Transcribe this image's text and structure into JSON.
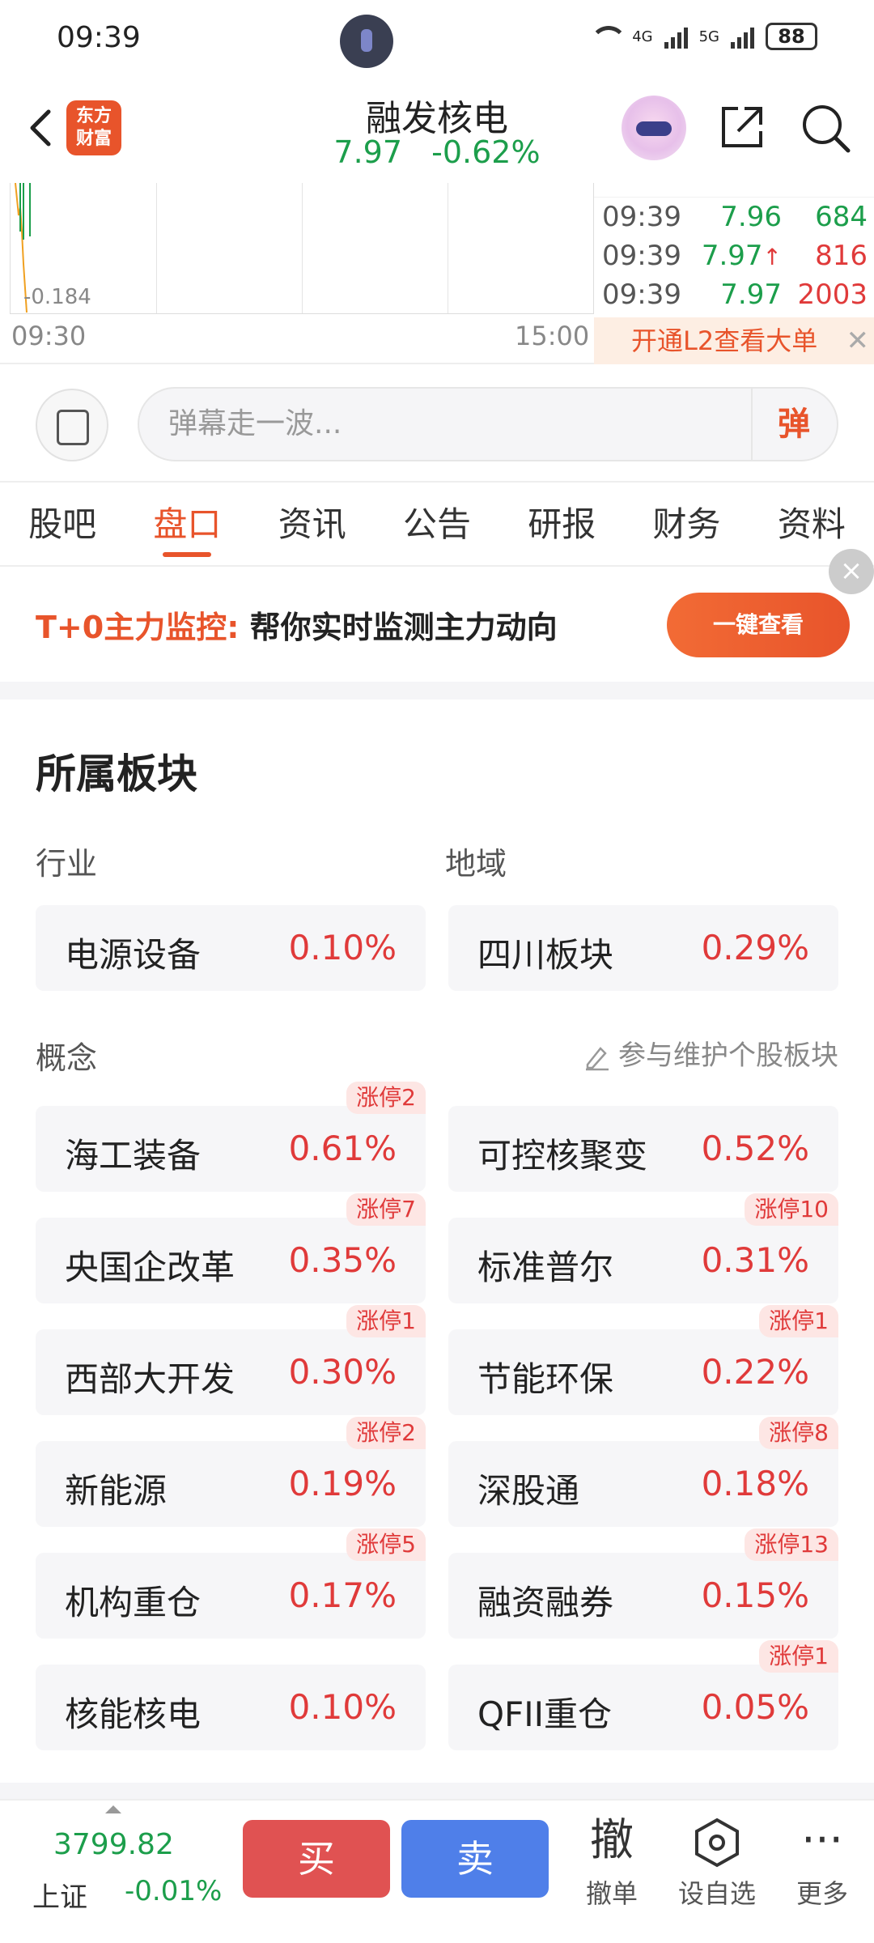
{
  "status_bar": {
    "time": "09:39",
    "signal_4g": "4G",
    "signal_5g": "5G",
    "battery": "88"
  },
  "header": {
    "logo_line1": "东方",
    "logo_line2": "财富",
    "stock_name": "融发核电",
    "price": "7.97",
    "change_pct": "-0.62%"
  },
  "chart": {
    "min_label": "-0.184",
    "x_start": "09:30",
    "x_end": "15:00",
    "ticks": [
      {
        "time": "09:39",
        "price": "7.96",
        "volume": "684",
        "direction": "",
        "color": "green"
      },
      {
        "time": "09:39",
        "price": "7.97",
        "volume": "816",
        "direction": "↑",
        "color": "red"
      },
      {
        "time": "09:39",
        "price": "7.97",
        "volume": "2003",
        "direction": "",
        "color": "red"
      }
    ],
    "l2_banner": "开通L2查看大单"
  },
  "danmaku": {
    "placeholder": "弹幕走一波...",
    "send_label": "弹"
  },
  "tabs": [
    {
      "label": "股吧",
      "active": false
    },
    {
      "label": "盘口",
      "active": true
    },
    {
      "label": "资讯",
      "active": false
    },
    {
      "label": "公告",
      "active": false
    },
    {
      "label": "研报",
      "active": false
    },
    {
      "label": "财务",
      "active": false
    },
    {
      "label": "资料",
      "active": false
    }
  ],
  "promo": {
    "highlight": "T+0主力监控:",
    "text": "帮你实时监测主力动向",
    "button": "一键查看",
    "close": "×"
  },
  "sectors": {
    "title": "所属板块",
    "industry_label": "行业",
    "region_label": "地域",
    "concept_label": "概念",
    "maintain_label": "参与维护个股板块",
    "industry": {
      "name": "电源设备",
      "pct": "0.10%"
    },
    "region": {
      "name": "四川板块",
      "pct": "0.29%"
    },
    "concepts": [
      {
        "name": "海工装备",
        "pct": "0.61%",
        "badge": "涨停2"
      },
      {
        "name": "可控核聚变",
        "pct": "0.52%",
        "badge": ""
      },
      {
        "name": "央国企改革",
        "pct": "0.35%",
        "badge": "涨停7"
      },
      {
        "name": "标准普尔",
        "pct": "0.31%",
        "badge": "涨停10"
      },
      {
        "name": "西部大开发",
        "pct": "0.30%",
        "badge": "涨停1"
      },
      {
        "name": "节能环保",
        "pct": "0.22%",
        "badge": "涨停1"
      },
      {
        "name": "新能源",
        "pct": "0.19%",
        "badge": "涨停2"
      },
      {
        "name": "深股通",
        "pct": "0.18%",
        "badge": "涨停8"
      },
      {
        "name": "机构重仓",
        "pct": "0.17%",
        "badge": "涨停5"
      },
      {
        "name": "融资融券",
        "pct": "0.15%",
        "badge": "涨停13"
      },
      {
        "name": "核能核电",
        "pct": "0.10%",
        "badge": ""
      },
      {
        "name": "QFII重仓",
        "pct": "0.05%",
        "badge": "涨停1"
      }
    ]
  },
  "bottom_bar": {
    "index_value": "3799.82",
    "index_name": "上证",
    "index_change": "-0.01%",
    "buy": "买",
    "sell": "卖",
    "cancel_icon": "撤",
    "cancel_label": "撤单",
    "watch_label": "设自选",
    "more_icon": "···",
    "more_label": "更多"
  },
  "colors": {
    "accent": "#e8542b",
    "up": "#e03a3a",
    "down": "#1c9e4b",
    "sell": "#4f7fe9"
  }
}
